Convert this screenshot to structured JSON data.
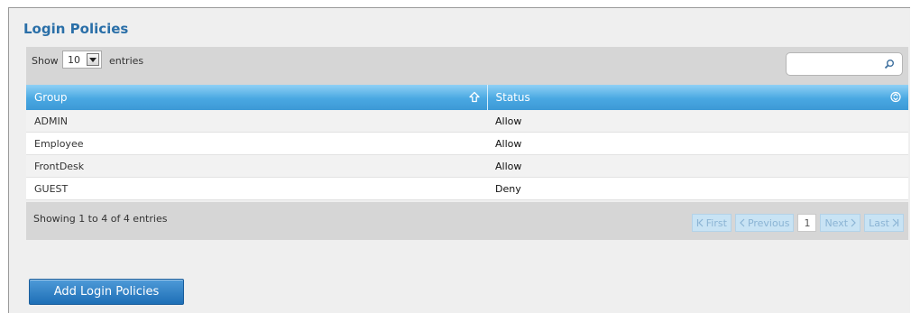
{
  "title": "Login Policies",
  "toolbar": {
    "show_label": "Show",
    "length_value": "10",
    "entries_label": "entries",
    "search_placeholder": ""
  },
  "columns": [
    "Group",
    "Status"
  ],
  "rows": [
    {
      "group": "ADMIN",
      "status": "Allow"
    },
    {
      "group": "Employee",
      "status": "Allow"
    },
    {
      "group": "FrontDesk",
      "status": "Allow"
    },
    {
      "group": "GUEST",
      "status": "Deny"
    }
  ],
  "footer": {
    "info": "Showing 1 to 4 of 4 entries",
    "first": "First",
    "previous": "Previous",
    "page": "1",
    "next": "Next",
    "last": "Last"
  },
  "add_button": "Add Login Policies",
  "colors": {
    "title": "#2a6fa8",
    "header": "#49a8e2",
    "button": "#1e6fb6"
  }
}
